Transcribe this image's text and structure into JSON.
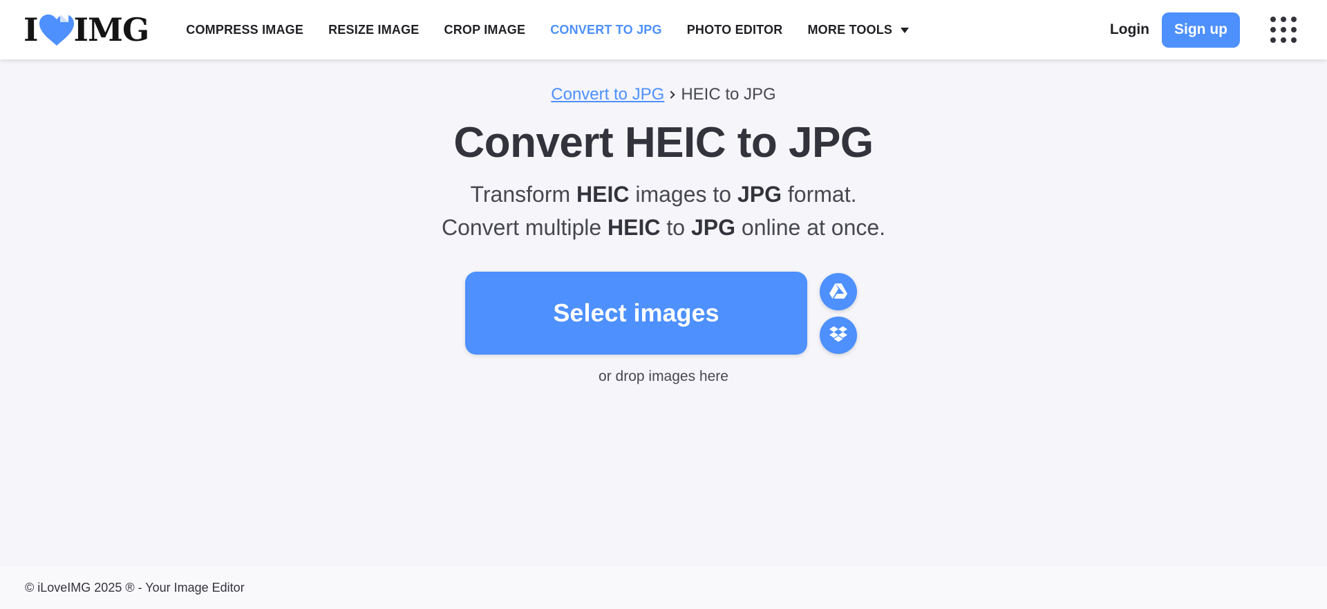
{
  "brand": {
    "logo_left": "I",
    "logo_right": "IMG",
    "accent_color": "#4d90fe",
    "logo_icon": "heart-icon"
  },
  "nav": {
    "items": [
      {
        "label": "COMPRESS IMAGE",
        "active": false
      },
      {
        "label": "RESIZE IMAGE",
        "active": false
      },
      {
        "label": "CROP IMAGE",
        "active": false
      },
      {
        "label": "CONVERT TO JPG",
        "active": true
      },
      {
        "label": "PHOTO EDITOR",
        "active": false
      },
      {
        "label": "MORE TOOLS",
        "active": false,
        "has_dropdown": true
      }
    ]
  },
  "header": {
    "login_label": "Login",
    "signup_label": "Sign up",
    "apps_icon": "apps-grid-icon"
  },
  "breadcrumb": {
    "parent": "Convert to JPG",
    "current": "HEIC to JPG"
  },
  "hero": {
    "title": "Convert HEIC to JPG",
    "line1": {
      "p1": "Transform ",
      "b1": "HEIC",
      "p2": " images to ",
      "b2": "JPG",
      "p3": " format."
    },
    "line2": {
      "p1": "Convert multiple ",
      "b1": "HEIC",
      "p2": " to ",
      "b2": "JPG",
      "p3": " online at once."
    }
  },
  "upload": {
    "select_label": "Select images",
    "drop_hint": "or drop images here",
    "cloud_sources": [
      "google-drive-icon",
      "dropbox-icon"
    ]
  },
  "footer": {
    "text": "© iLoveIMG 2025 ® - Your Image Editor"
  }
}
